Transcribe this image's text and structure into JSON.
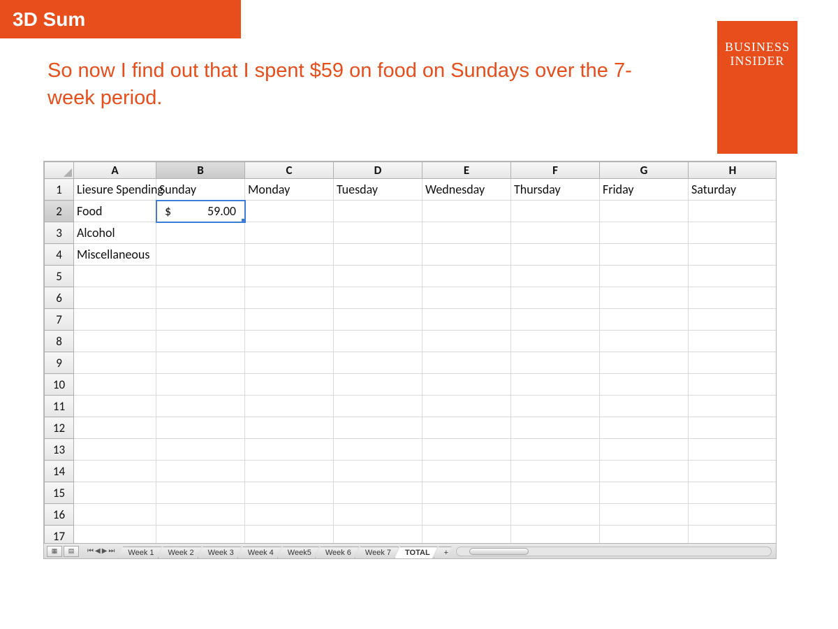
{
  "banner": {
    "title": "3D Sum"
  },
  "logo": {
    "line1": "BUSINESS",
    "line2": "INSIDER"
  },
  "caption": "So now I find out that I spent $59 on food on Sundays over the 7-week period.",
  "sheet": {
    "columns": [
      "A",
      "B",
      "C",
      "D",
      "E",
      "F",
      "G",
      "H"
    ],
    "selected_col": "B",
    "selected_row": 2,
    "total_rows": 17,
    "rows": {
      "1": {
        "A": "Liesure Spending",
        "B": "Sunday",
        "C": "Monday",
        "D": "Tuesday",
        "E": "Wednesday",
        "F": "Thursday",
        "G": "Friday",
        "H": "Saturday"
      },
      "2": {
        "A": "Food",
        "B_currency": "$",
        "B_value": "59.00"
      },
      "3": {
        "A": "Alcohol"
      },
      "4": {
        "A": "Miscellaneous"
      }
    },
    "tabs": [
      "Week 1",
      "Week 2",
      "Week 3",
      "Week 4",
      "Week5",
      "Week 6",
      "Week 7",
      "TOTAL"
    ],
    "active_tab": "TOTAL",
    "nav": {
      "first": "⏮",
      "prev": "◀",
      "next": "▶",
      "last": "⏭"
    }
  }
}
